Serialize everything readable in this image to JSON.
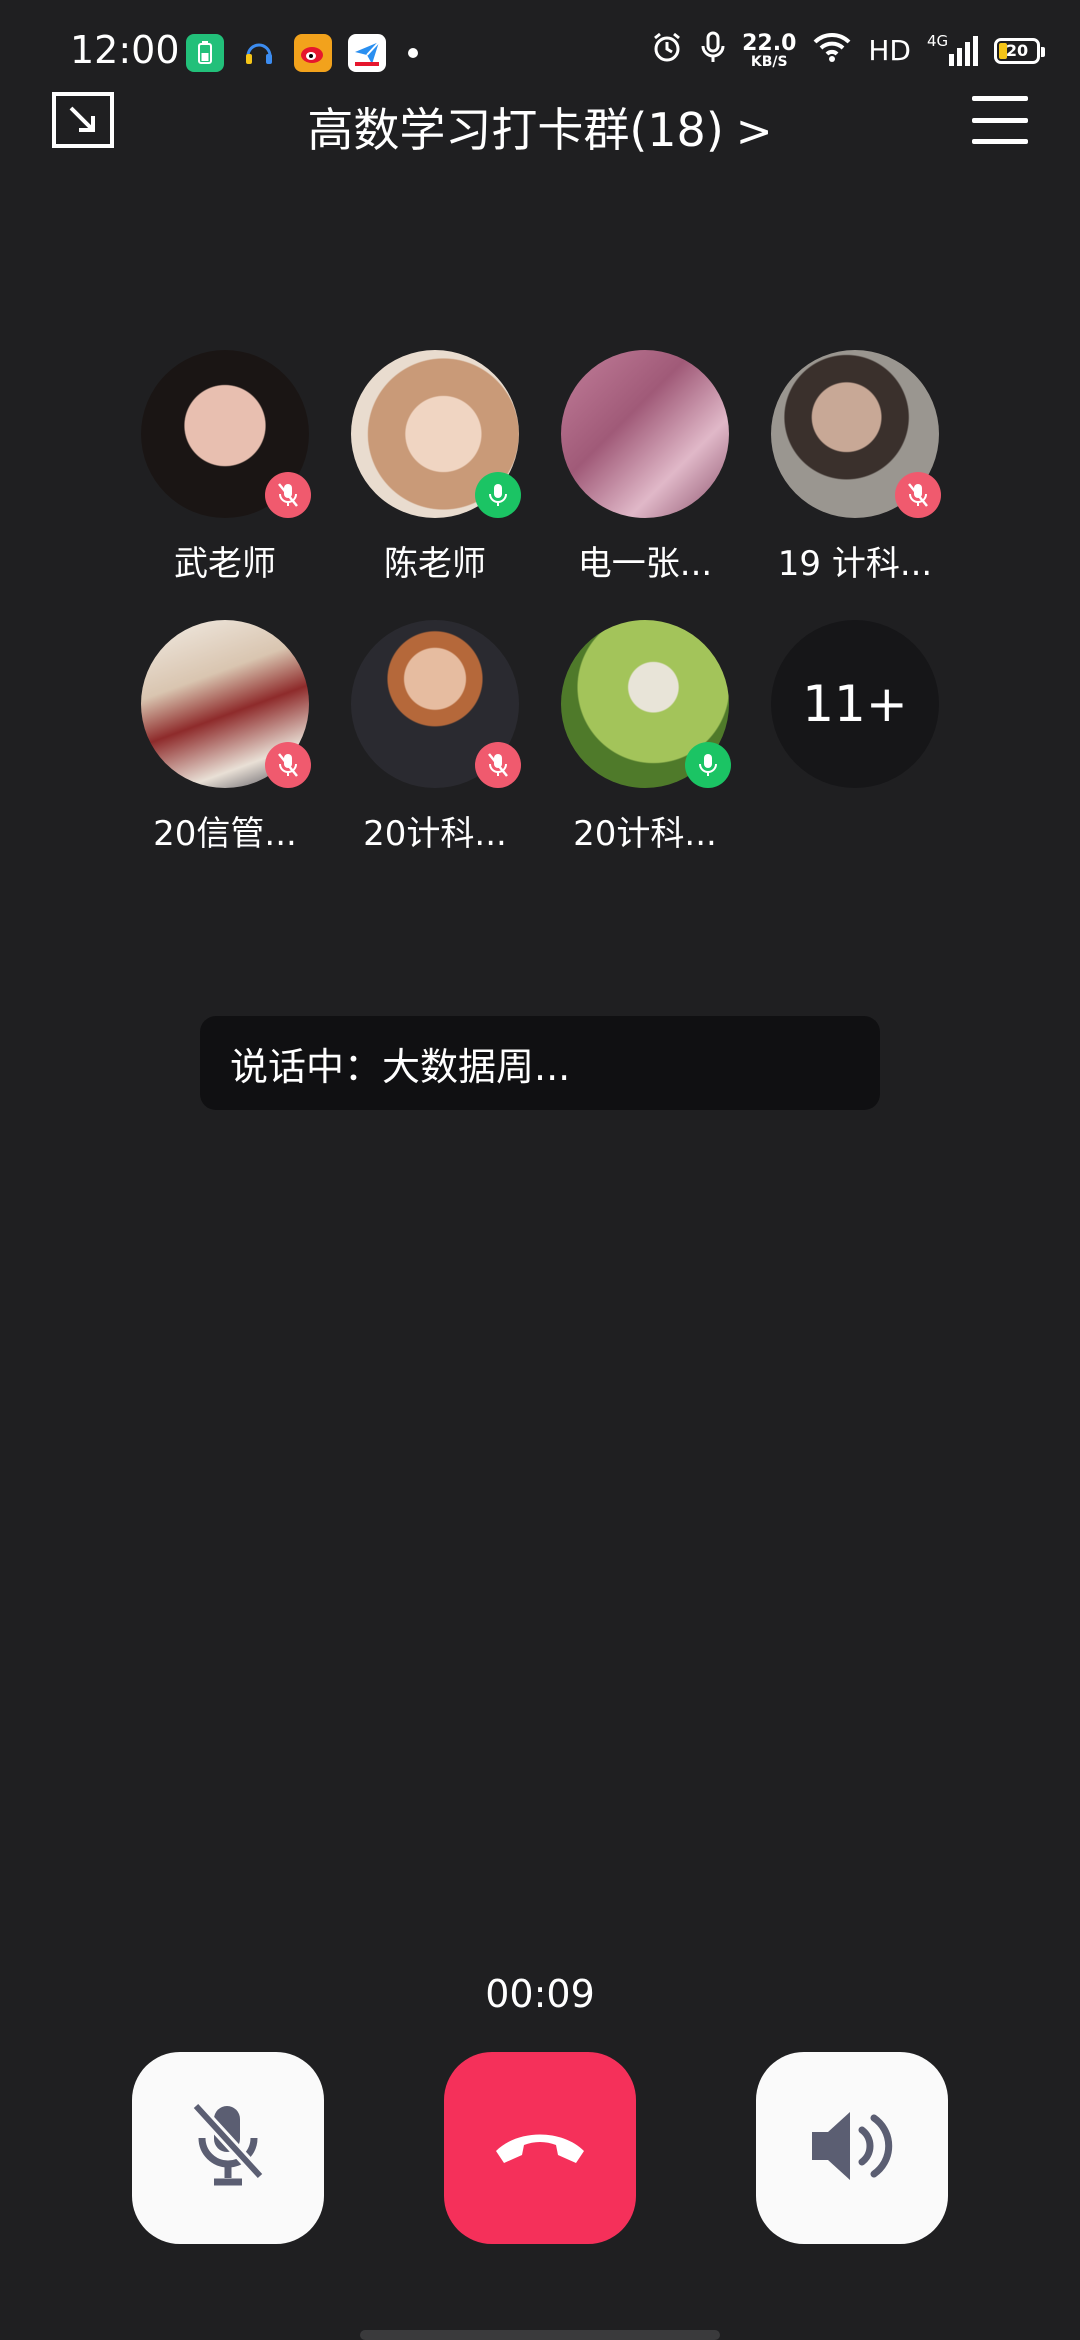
{
  "status_bar": {
    "time": "12:00",
    "net_speed_value": "22.0",
    "net_speed_unit": "KB/S",
    "hd_label": "HD",
    "signal_label": "4G",
    "battery_level": "20"
  },
  "header": {
    "title": "高数学习打卡群(18)",
    "chevron": ">"
  },
  "members": [
    {
      "name": "武老师",
      "mic": "off",
      "avatar_color": "#2a2220"
    },
    {
      "name": "陈老师",
      "mic": "on",
      "avatar_color": "#e8cdb6"
    },
    {
      "name": "电一张...",
      "mic": "none",
      "avatar_color": "#b87d95"
    },
    {
      "name": "19 计科...",
      "mic": "off",
      "avatar_color": "#8c8680"
    },
    {
      "name": "20信管...",
      "mic": "off",
      "avatar_color": "#d7cabb"
    },
    {
      "name": "20计科...",
      "mic": "off",
      "avatar_color": "#4a3a34"
    },
    {
      "name": "20计科...",
      "mic": "on",
      "avatar_color": "#7ba24a"
    }
  ],
  "more_count": "11+",
  "speaking": "说话中：大数据周...",
  "timer": "00:09",
  "colors": {
    "background": "#1f1f21",
    "mic_on": "#1bc464",
    "mic_off": "#f05a6e",
    "hangup": "#f5305a"
  },
  "icons": {
    "minimize": "minimize-window-icon",
    "menu": "hamburger-menu-icon",
    "mute": "microphone-muted-icon",
    "hangup": "phone-hangup-icon",
    "speaker": "speaker-volume-icon"
  }
}
